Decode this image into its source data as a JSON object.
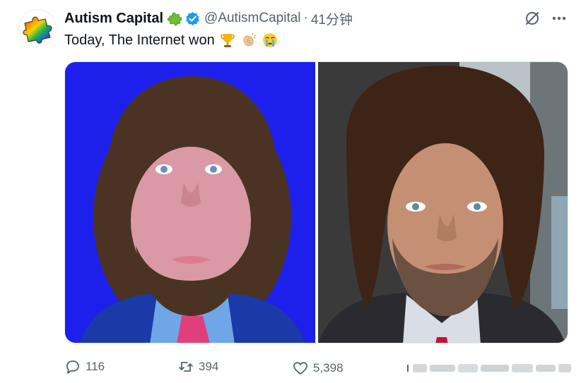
{
  "post": {
    "author": {
      "display_name": "Autism Capital",
      "handle": "@AutismCapital",
      "verified": true,
      "avatar_icon": "rainbow-puzzle-piece-icon",
      "name_badge_icon": "puzzle-piece-green-icon"
    },
    "separator": "·",
    "timestamp": "41分钟",
    "text": "Today, The Internet won",
    "emojis": [
      "trophy-icon",
      "clapping-hands-icon",
      "crying-face-icon"
    ],
    "header_actions": [
      "grok-icon",
      "more-icon"
    ],
    "media": [
      {
        "icon": "photo-blue-background-man"
      },
      {
        "icon": "photo-selfie-man-wig"
      }
    ]
  },
  "actions": {
    "reply_count": "116",
    "repost_count": "394",
    "like_count": "5,398"
  },
  "colors": {
    "text_primary": "#0f1419",
    "text_secondary": "#536471",
    "verified_blue": "#1d9bf0",
    "left_photo_bg": "#1c1ee6"
  }
}
